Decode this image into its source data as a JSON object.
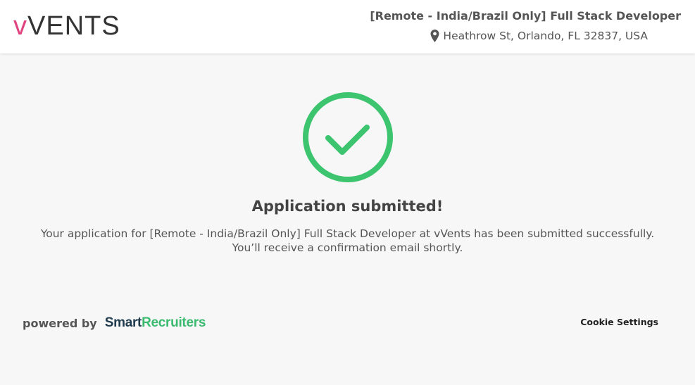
{
  "header": {
    "logo_v": "v",
    "logo_rest": "VENTS",
    "job_title": "[Remote - India/Brazil Only] Full Stack Developer",
    "location": "Heathrow St, Orlando, FL 32837, USA",
    "location_icon": "map-pin-icon"
  },
  "main": {
    "status_icon": "checkmark-circle-icon",
    "title": "Application submitted!",
    "message": "Your application for [Remote - India/Brazil Only] Full Stack Developer at vVents has been submitted successfully. You’ll receive a confirmation email shortly."
  },
  "footer": {
    "powered_by": "powered by",
    "brand_part1": "Smart",
    "brand_part2": "Recruiters",
    "cookie_settings": "Cookie Settings"
  },
  "colors": {
    "logo_accent": "#e0437f",
    "success_green": "#3cc46e",
    "brand_dark": "#1f3b4d",
    "brand_green": "#3aba6f",
    "background": "#f7f7f7"
  }
}
